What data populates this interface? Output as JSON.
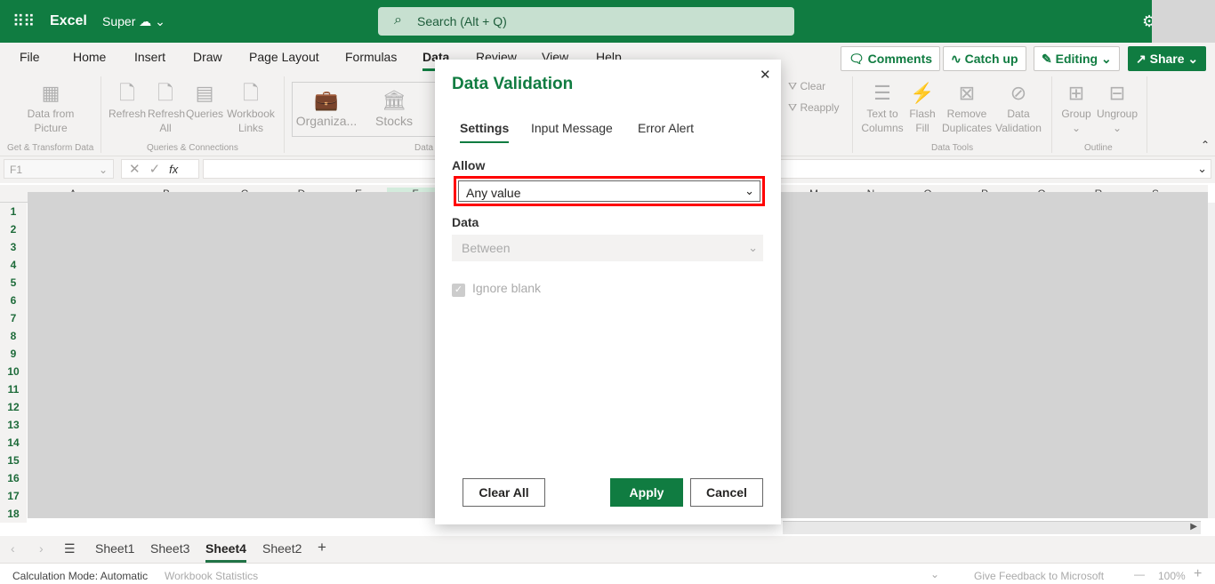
{
  "app": {
    "name": "Excel",
    "doc": "Super",
    "search_placeholder": "Search (Alt + Q)"
  },
  "colors": {
    "brand": "#107c41",
    "highlight": "#ff0000"
  },
  "tabs": [
    "File",
    "Home",
    "Insert",
    "Draw",
    "Page Layout",
    "Formulas",
    "Data",
    "Review",
    "View",
    "Help"
  ],
  "active_tab": "Data",
  "top_buttons": {
    "comments": "Comments",
    "catchup": "Catch up",
    "editing": "Editing",
    "share": "Share"
  },
  "ribbon": {
    "items": [
      "Data from Picture",
      "Refresh",
      "Refresh All",
      "Queries",
      "Workbook Links",
      "Organiza...",
      "Stocks",
      "Clear",
      "Reapply",
      "Text to Columns",
      "Flash Fill",
      "Remove Duplicates",
      "Data Validation",
      "Group",
      "Ungroup"
    ],
    "groups": [
      "Get & Transform Data",
      "Queries & Connections",
      "Data",
      "Data Tools",
      "Outline"
    ]
  },
  "formula_bar": {
    "name_box": "F1",
    "fx": "fx"
  },
  "columns": [
    "A",
    "B",
    "C",
    "D",
    "E",
    "F",
    "M",
    "N",
    "O",
    "P",
    "Q",
    "R",
    "S"
  ],
  "rows": [
    "1",
    "2",
    "3",
    "4",
    "5",
    "6",
    "7",
    "8",
    "9",
    "10",
    "11",
    "12",
    "13",
    "14",
    "15",
    "16",
    "17",
    "18"
  ],
  "sheets": [
    "Sheet1",
    "Sheet3",
    "Sheet4",
    "Sheet2"
  ],
  "active_sheet": "Sheet4",
  "status": {
    "calc": "Calculation Mode: Automatic",
    "stats": "Workbook Statistics",
    "feedback": "Give Feedback to Microsoft",
    "zoom": "100%"
  },
  "dialog": {
    "title": "Data Validation",
    "tabs": [
      "Settings",
      "Input Message",
      "Error Alert"
    ],
    "allow_label": "Allow",
    "allow_value": "Any value",
    "data_label": "Data",
    "data_value": "Between",
    "ignore_blank": "Ignore blank",
    "ignore_blank_checked": true,
    "clear_all": "Clear All",
    "apply": "Apply",
    "cancel": "Cancel"
  }
}
